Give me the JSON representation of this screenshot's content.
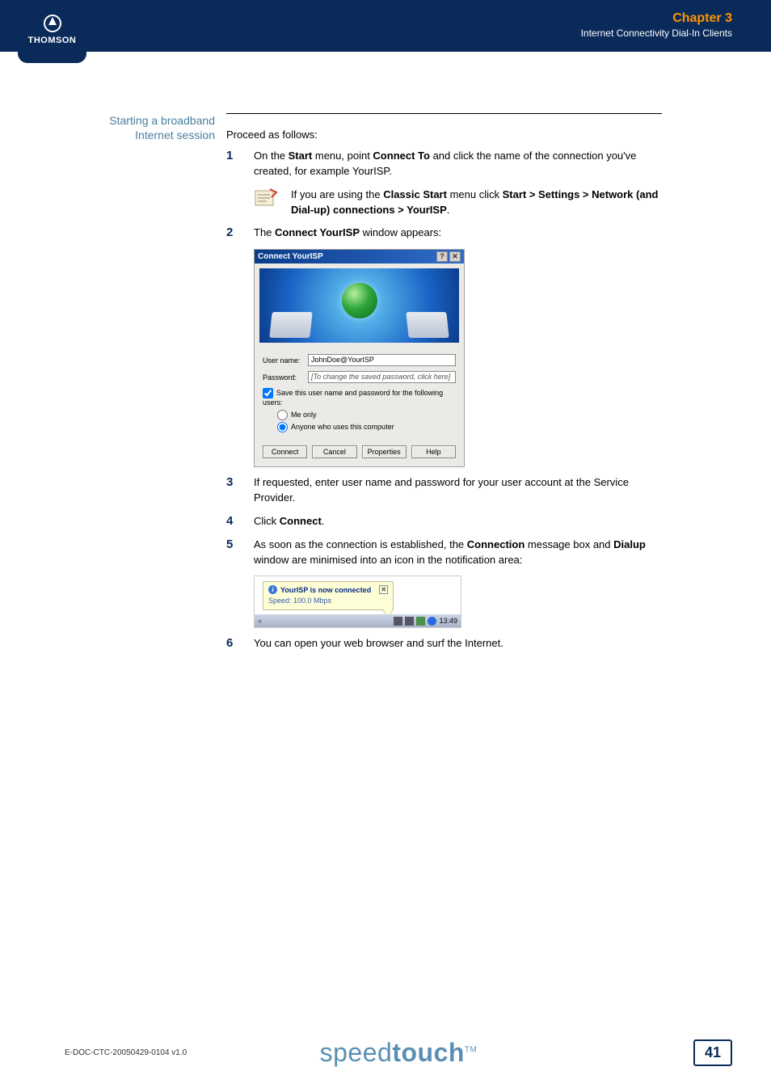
{
  "header": {
    "logo_text": "THOMSON",
    "chapter": "Chapter 3",
    "subtitle": "Internet Connectivity Dial-In Clients"
  },
  "section": {
    "label_line1": "Starting a broadband",
    "label_line2": "Internet session",
    "lead": "Proceed as follows:"
  },
  "steps": {
    "s1_num": "1",
    "s1_a": "On the ",
    "s1_b": "Start",
    "s1_c": " menu, point ",
    "s1_d": "Connect To",
    "s1_e": " and click the name of the connection you've created, for example YourISP.",
    "note_a": "If you are using the ",
    "note_b": "Classic Start",
    "note_c": " menu click ",
    "note_d": "Start > Settings > Network (and Dial-up) connections > YourISP",
    "note_e": ".",
    "s2_num": "2",
    "s2_a": "The ",
    "s2_b": "Connect YourISP",
    "s2_c": " window appears:",
    "s3_num": "3",
    "s3_text": "If requested, enter user name and password for your user account at the Service Provider.",
    "s4_num": "4",
    "s4_a": "Click ",
    "s4_b": "Connect",
    "s4_c": ".",
    "s5_num": "5",
    "s5_a": "As soon as the connection is established, the ",
    "s5_b": "Connection",
    "s5_c": " message box and ",
    "s5_d": "Dialup",
    "s5_e": " window are minimised into an icon in the notification area:",
    "s6_num": "6",
    "s6_text": "You can open your web browser and surf the Internet."
  },
  "dialog": {
    "title": "Connect YourISP",
    "help_btn": "?",
    "close_btn": "✕",
    "lbl_user": "User name:",
    "val_user": "JohnDoe@YourISP",
    "lbl_pass": "Password:",
    "val_pass": "[To change the saved password, click here]",
    "chk_save": "Save this user name and password for the following users:",
    "radio_me": "Me only",
    "radio_any": "Anyone who uses this computer",
    "btn_connect": "Connect",
    "btn_cancel": "Cancel",
    "btn_props": "Properties",
    "btn_help": "Help"
  },
  "tray": {
    "balloon_title": "YourISP is now connected",
    "balloon_close": "✕",
    "balloon_speed": "Speed: 100.0 Mbps",
    "expand": "«",
    "time": "13:49"
  },
  "footer": {
    "docid": "E-DOC-CTC-20050429-0104 v1.0",
    "brand_a": "speed",
    "brand_b": "touch",
    "brand_tm": "TM",
    "page": "41"
  }
}
